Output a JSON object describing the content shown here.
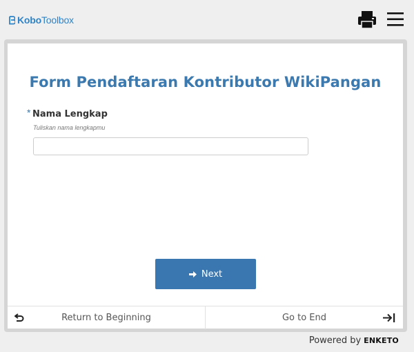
{
  "header": {
    "logo_kobo": "Kobo",
    "logo_toolbox": "Toolbox",
    "print_icon": "printer-icon",
    "menu_icon": "hamburger-menu-icon"
  },
  "form": {
    "title": "Form Pendaftaran Kontributor WikiPangan",
    "question": {
      "required_marker": "*",
      "label": "Nama Lengkap",
      "hint": "Tuliskan nama lengkapmu",
      "value": ""
    },
    "next_label": "Next"
  },
  "footer_nav": {
    "return_label": "Return to Beginning",
    "end_label": "Go to End"
  },
  "powered_by": {
    "text": "Powered by",
    "brand": "ENKETO"
  },
  "colors": {
    "accent": "#3a77b0",
    "logo": "#2f83c6",
    "background": "#efefef"
  }
}
